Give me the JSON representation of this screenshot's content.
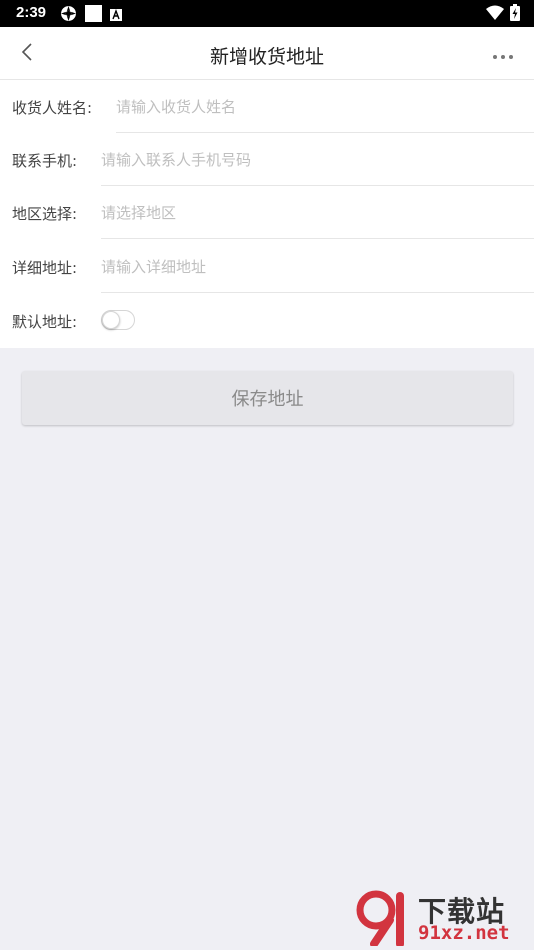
{
  "status_bar": {
    "time": "2:39",
    "left_icons": [
      "settings-cog-icon",
      "white-square-icon",
      "a-box-icon"
    ],
    "right_icons": [
      "wifi-icon",
      "battery-charging-icon"
    ]
  },
  "nav": {
    "title": "新增收货地址",
    "back_icon": "chevron-left-icon",
    "more_icon": "more-dots-icon"
  },
  "form": {
    "fields": [
      {
        "label": "收货人姓名:",
        "placeholder": "请输入收货人姓名",
        "value": ""
      },
      {
        "label": "联系手机:",
        "placeholder": "请输入联系人手机号码",
        "value": ""
      },
      {
        "label": "地区选择:",
        "placeholder": "请选择地区",
        "value": ""
      },
      {
        "label": "详细地址:",
        "placeholder": "请输入详细地址",
        "value": ""
      }
    ],
    "default_toggle": {
      "label": "默认地址:",
      "on": false
    }
  },
  "save_label": "保存地址",
  "watermark": {
    "text": "下载站",
    "url": "91xz.net"
  },
  "colors": {
    "background": "#efeff4",
    "button_bg": "#e6e6ea",
    "placeholder": "#bfbfbf",
    "watermark_red": "#d2343f"
  }
}
